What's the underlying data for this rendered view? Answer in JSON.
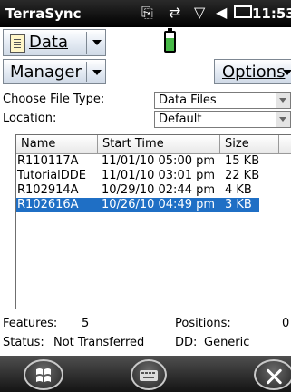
{
  "status_bar": {
    "app_title": "TerraSync",
    "clock": "11:53",
    "icons": [
      "sync-icon",
      "connection-icon",
      "no-signal-icon",
      "volume-icon",
      "battery-status-icon"
    ]
  },
  "toolbar": {
    "data_menu_label": "Data",
    "manager_menu_label": "Manager",
    "options_menu_label": "Options",
    "gps_battery_icon": "battery-icon"
  },
  "form": {
    "file_type_label": "Choose File Type:",
    "file_type_value": "Data Files",
    "location_label": "Location:",
    "location_value": "Default"
  },
  "file_list": {
    "columns": [
      "Name",
      "Start Time",
      "Size"
    ],
    "rows": [
      {
        "name": "R110117A",
        "start_time": "11/01/10 05:00 pm",
        "size": "15 KB"
      },
      {
        "name": "TutorialDDE",
        "start_time": "11/01/10 03:01 pm",
        "size": "22 KB"
      },
      {
        "name": "R102914A",
        "start_time": "10/29/10 02:44 pm",
        "size": "4 KB"
      },
      {
        "name": "R102616A",
        "start_time": "10/26/10 04:49 pm",
        "size": "3 KB"
      }
    ],
    "selected_row": 3
  },
  "info": {
    "features_label": "Features:",
    "features_value": "5",
    "positions_label": "Positions:",
    "positions_value": "0",
    "status_label": "Status:",
    "status_value": "Not Transferred",
    "dd_label": "DD:",
    "dd_value": "Generic"
  },
  "colors": {
    "selection": "#1f6fc5",
    "status_bar": "#000000"
  }
}
